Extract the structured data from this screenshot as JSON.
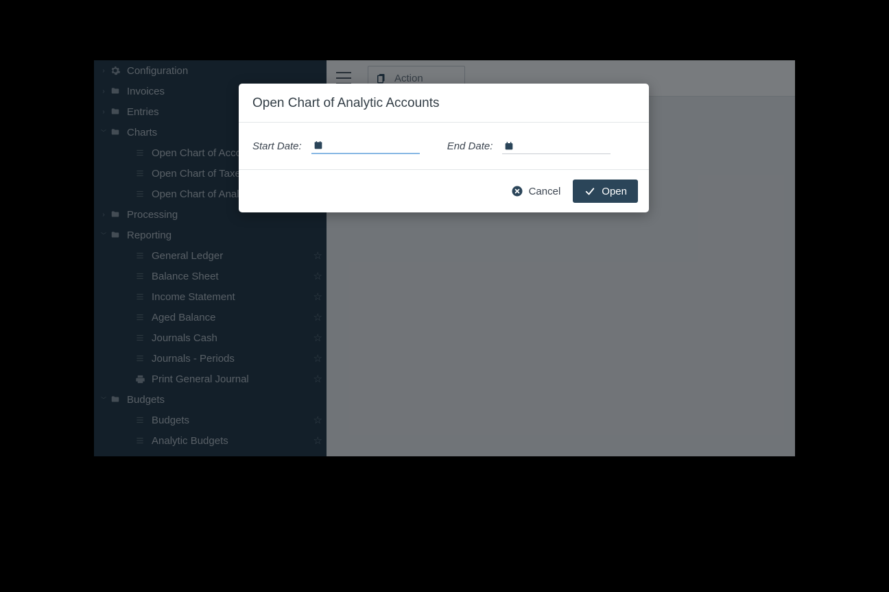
{
  "sidebar": {
    "items": [
      {
        "label": "Configuration",
        "type": "gear",
        "collapsed": true,
        "starred": false,
        "indent": 0
      },
      {
        "label": "Invoices",
        "type": "folder",
        "collapsed": true,
        "starred": false,
        "indent": 0
      },
      {
        "label": "Entries",
        "type": "folder",
        "collapsed": true,
        "starred": false,
        "indent": 0
      },
      {
        "label": "Charts",
        "type": "folder",
        "collapsed": false,
        "starred": false,
        "indent": 0
      },
      {
        "label": "Open Chart of Accounts",
        "type": "list",
        "collapsed": null,
        "starred": false,
        "indent": 1
      },
      {
        "label": "Open Chart of Taxes",
        "type": "list",
        "collapsed": null,
        "starred": false,
        "indent": 1
      },
      {
        "label": "Open Chart of Analytic Accounts",
        "type": "list",
        "collapsed": null,
        "starred": false,
        "indent": 1
      },
      {
        "label": "Processing",
        "type": "folder",
        "collapsed": true,
        "starred": false,
        "indent": 0
      },
      {
        "label": "Reporting",
        "type": "folder",
        "collapsed": false,
        "starred": false,
        "indent": 0
      },
      {
        "label": "General Ledger",
        "type": "list",
        "collapsed": null,
        "starred": true,
        "indent": 1
      },
      {
        "label": "Balance Sheet",
        "type": "list",
        "collapsed": null,
        "starred": true,
        "indent": 1
      },
      {
        "label": "Income Statement",
        "type": "list",
        "collapsed": null,
        "starred": true,
        "indent": 1
      },
      {
        "label": "Aged Balance",
        "type": "list",
        "collapsed": null,
        "starred": true,
        "indent": 1
      },
      {
        "label": "Journals Cash",
        "type": "list",
        "collapsed": null,
        "starred": true,
        "indent": 1
      },
      {
        "label": "Journals - Periods",
        "type": "list",
        "collapsed": null,
        "starred": true,
        "indent": 1
      },
      {
        "label": "Print General Journal",
        "type": "printer",
        "collapsed": null,
        "starred": true,
        "indent": 1
      },
      {
        "label": "Budgets",
        "type": "folder",
        "collapsed": false,
        "starred": false,
        "indent": 0
      },
      {
        "label": "Budgets",
        "type": "list",
        "collapsed": null,
        "starred": true,
        "indent": 1
      },
      {
        "label": "Analytic Budgets",
        "type": "list",
        "collapsed": null,
        "starred": true,
        "indent": 1
      }
    ]
  },
  "toolbar": {
    "action_label": "Action"
  },
  "modal": {
    "title": "Open Chart of Analytic Accounts",
    "start_date_label": "Start Date:",
    "end_date_label": "End Date:",
    "start_date_value": "",
    "end_date_value": "",
    "cancel_label": "Cancel",
    "open_label": "Open"
  }
}
